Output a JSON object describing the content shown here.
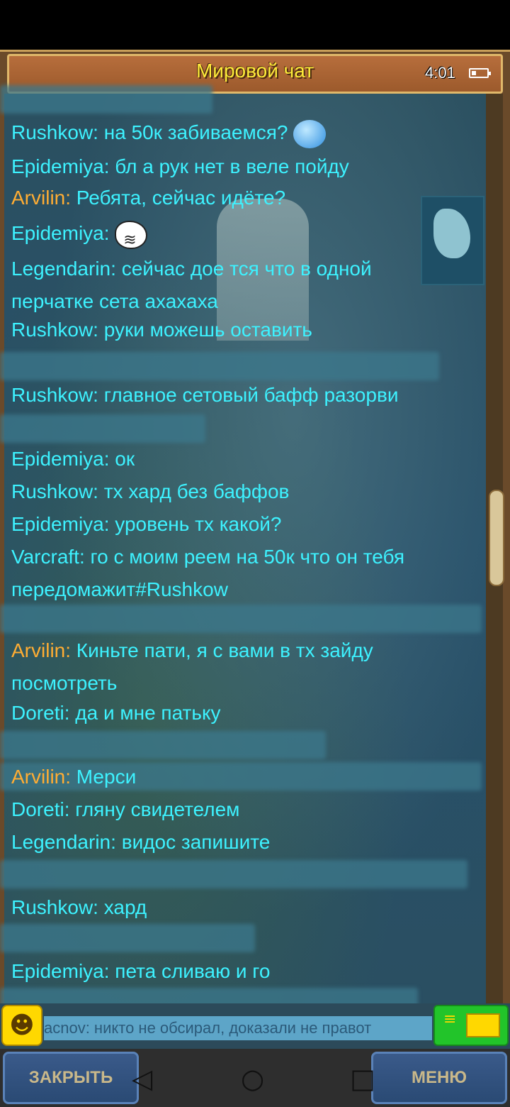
{
  "title": "Мировой чат",
  "status": {
    "time": "4:01"
  },
  "messages": [
    {
      "nick": "Rushkow:",
      "text": "на 50к забиваемся?",
      "color": "cyan",
      "emoji": "bubble"
    },
    {
      "nick": "Epidemiya:",
      "text": "бл   а рук нет в веле пойду",
      "color": "cyan"
    },
    {
      "nick": "Arvilin:",
      "text": "Ребята, сейчас идёте?",
      "color": "orange"
    },
    {
      "nick": "Epidemiya:",
      "text": "",
      "color": "cyan",
      "emoji": "troll"
    },
    {
      "nick": "Legendarin:",
      "text": "сейчас дое   тся что в одной перчатке сета ахахаха",
      "color": "cyan"
    },
    {
      "nick": "Rushkow:",
      "text": "руки можешь оставить",
      "color": "cyan"
    },
    {
      "nick": "Rushkow:",
      "text": "главное сетовый бафф разорви",
      "color": "cyan"
    },
    {
      "nick": "Epidemiya:",
      "text": "ок",
      "color": "cyan"
    },
    {
      "nick": "Rushkow:",
      "text": "тх хард без баффов",
      "color": "cyan"
    },
    {
      "nick": "Epidemiya:",
      "text": "уровень тх какой?",
      "color": "cyan"
    },
    {
      "nick": "Varcraft:",
      "text": "го с моим реем на 50к что он тебя передомажит#Rushkow",
      "color": "cyan"
    },
    {
      "nick": "Arvilin:",
      "text": "Киньте пати, я с вами в тх зайду посмотреть",
      "color": "orange"
    },
    {
      "nick": "Doreti:",
      "text": "да и мне патьку",
      "color": "cyan"
    },
    {
      "nick": "Arvilin:",
      "text": "Мерси",
      "color": "orange"
    },
    {
      "nick": "Doreti:",
      "text": "гляну свидетелем",
      "color": "cyan"
    },
    {
      "nick": "Legendarin:",
      "text": "видос запишите",
      "color": "cyan"
    },
    {
      "nick": "Rushkow:",
      "text": "хард",
      "color": "cyan"
    },
    {
      "nick": "Epidemiya:",
      "text": "пета сливаю и го",
      "color": "cyan"
    }
  ],
  "ticker": "acnov: никто не обсирал, доказали не правот",
  "buttons": {
    "close": "ЗАКРЫТЬ",
    "menu": "МЕНЮ"
  },
  "nav": {
    "back": "◁",
    "home": "○",
    "recent": "□"
  },
  "colors": {
    "cyan": "#3df2ff",
    "orange": "#ffad33"
  }
}
